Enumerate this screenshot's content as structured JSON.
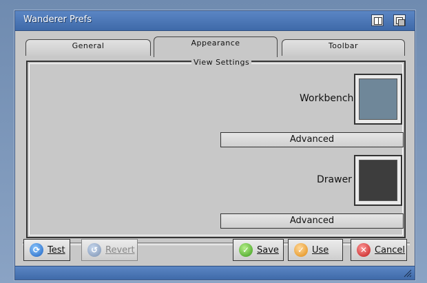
{
  "window": {
    "title": "Wanderer Prefs",
    "title_buttons": [
      "zoom-icon",
      "depth-icon"
    ],
    "accent_color": "#4a76b6"
  },
  "tabs": [
    {
      "label": "General",
      "active": false
    },
    {
      "label": "Appearance",
      "active": true
    },
    {
      "label": "Toolbar",
      "active": false
    }
  ],
  "view_settings": {
    "group_label": "View Settings",
    "workbench": {
      "label": "Workbench",
      "color": "#6f8799",
      "advanced_label": "Advanced"
    },
    "drawer": {
      "label": "Drawer",
      "color": "#3d3d3d",
      "advanced_label": "Advanced"
    }
  },
  "buttons": {
    "test": {
      "label": "Test",
      "icon": "test-icon",
      "enabled": true
    },
    "revert": {
      "label": "Revert",
      "icon": "revert-icon",
      "enabled": false
    },
    "save": {
      "label": "Save",
      "icon": "checkmark-icon",
      "enabled": true
    },
    "use": {
      "label": "Use",
      "icon": "checkmark-icon",
      "enabled": true
    },
    "cancel": {
      "label": "Cancel",
      "icon": "close-icon",
      "enabled": true
    }
  }
}
